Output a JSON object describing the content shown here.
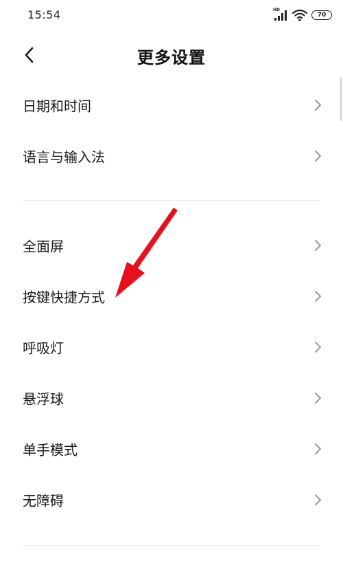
{
  "status_bar": {
    "time": "15:54",
    "hd_label": "HD",
    "battery_level": "70"
  },
  "header": {
    "title": "更多设置"
  },
  "sections": [
    {
      "items": [
        {
          "label": "日期和时间"
        },
        {
          "label": "语言与输入法"
        }
      ]
    },
    {
      "items": [
        {
          "label": "全面屏"
        },
        {
          "label": "按键快捷方式"
        },
        {
          "label": "呼吸灯"
        },
        {
          "label": "悬浮球"
        },
        {
          "label": "单手模式"
        },
        {
          "label": "无障碍"
        }
      ]
    }
  ],
  "colors": {
    "annotation_arrow": "#e8101c",
    "divider": "#ececec",
    "chevron": "#9a9a9a"
  }
}
